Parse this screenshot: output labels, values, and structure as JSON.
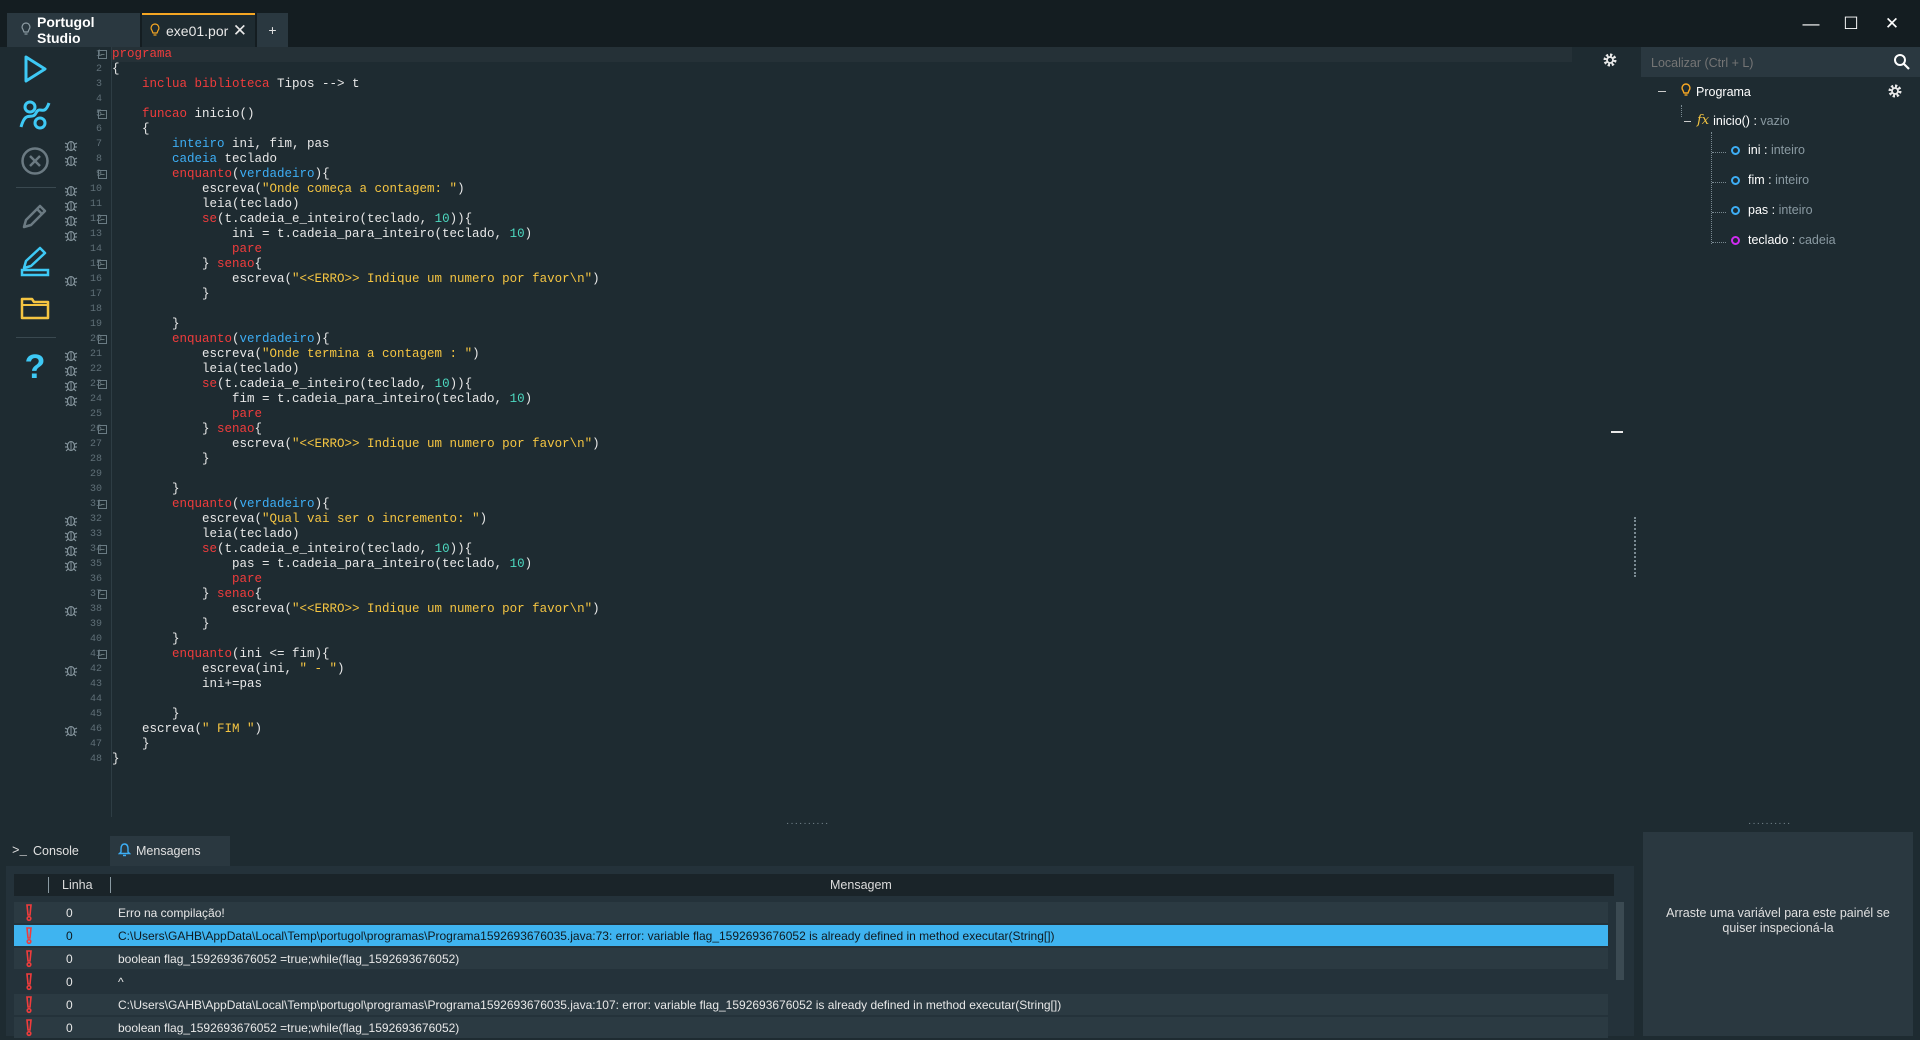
{
  "titlebar": {
    "home_tab": "Portugol Studio",
    "file_tab": "exe01.por",
    "add_tab": "+",
    "close_symbol": "✕",
    "window_minimize": "—",
    "window_maximize": "☐",
    "window_close": "✕"
  },
  "toolbar": {
    "icons": [
      "run-icon",
      "debug-step-icon",
      "stop-icon",
      "edit-icon",
      "edit-save-icon",
      "folder-icon",
      "help-icon"
    ],
    "help_symbol": "?"
  },
  "editor": {
    "line_numbers": [
      "1",
      "2",
      "3",
      "4",
      "5",
      "6",
      "7",
      "8",
      "9",
      "10",
      "11",
      "12",
      "13",
      "14",
      "15",
      "16",
      "17",
      "18",
      "19",
      "20",
      "21",
      "22",
      "23",
      "24",
      "25",
      "26",
      "27",
      "28",
      "29",
      "30",
      "31",
      "32",
      "33",
      "34",
      "35",
      "36",
      "37",
      "38",
      "39",
      "40",
      "41",
      "42",
      "43",
      "44",
      "45",
      "46",
      "47",
      "48"
    ],
    "lines": [
      [
        [
          "kw",
          "programa"
        ]
      ],
      [
        [
          "plain",
          "{"
        ]
      ],
      [
        [
          "plain",
          "    "
        ],
        [
          "kw",
          "inclua biblioteca"
        ],
        [
          "plain",
          " Tipos --> t"
        ]
      ],
      [],
      [
        [
          "plain",
          "    "
        ],
        [
          "kw",
          "funcao"
        ],
        [
          "plain",
          " inicio()"
        ]
      ],
      [
        [
          "plain",
          "    {"
        ]
      ],
      [
        [
          "plain",
          "        "
        ],
        [
          "type",
          "inteiro"
        ],
        [
          "plain",
          " ini, fim, pas"
        ]
      ],
      [
        [
          "plain",
          "        "
        ],
        [
          "type",
          "cadeia"
        ],
        [
          "plain",
          " teclado"
        ]
      ],
      [
        [
          "plain",
          "        "
        ],
        [
          "kw",
          "enquanto"
        ],
        [
          "plain",
          "("
        ],
        [
          "bool",
          "verdadeiro"
        ],
        [
          "plain",
          "){"
        ]
      ],
      [
        [
          "plain",
          "            escreva("
        ],
        [
          "str",
          "\"Onde começa a contagem: \""
        ],
        [
          "plain",
          ")"
        ]
      ],
      [
        [
          "plain",
          "            leia(teclado)"
        ]
      ],
      [
        [
          "plain",
          "            "
        ],
        [
          "kw",
          "se"
        ],
        [
          "plain",
          "(t.cadeia_e_inteiro(teclado, "
        ],
        [
          "num",
          "10"
        ],
        [
          "plain",
          ")){"
        ]
      ],
      [
        [
          "plain",
          "                ini = t.cadeia_para_inteiro(teclado, "
        ],
        [
          "num",
          "10"
        ],
        [
          "plain",
          ")"
        ]
      ],
      [
        [
          "plain",
          "                "
        ],
        [
          "kw",
          "pare"
        ]
      ],
      [
        [
          "plain",
          "            } "
        ],
        [
          "kw",
          "senao"
        ],
        [
          "plain",
          "{"
        ]
      ],
      [
        [
          "plain",
          "                escreva("
        ],
        [
          "str",
          "\"<<ERRO>> Indique um numero por favor\\n\""
        ],
        [
          "plain",
          ")"
        ]
      ],
      [
        [
          "plain",
          "            }"
        ]
      ],
      [],
      [
        [
          "plain",
          "        }"
        ]
      ],
      [
        [
          "plain",
          "        "
        ],
        [
          "kw",
          "enquanto"
        ],
        [
          "plain",
          "("
        ],
        [
          "bool",
          "verdadeiro"
        ],
        [
          "plain",
          "){"
        ]
      ],
      [
        [
          "plain",
          "            escreva("
        ],
        [
          "str",
          "\"Onde termina a contagem : \""
        ],
        [
          "plain",
          ")"
        ]
      ],
      [
        [
          "plain",
          "            leia(teclado)"
        ]
      ],
      [
        [
          "plain",
          "            "
        ],
        [
          "kw",
          "se"
        ],
        [
          "plain",
          "(t.cadeia_e_inteiro(teclado, "
        ],
        [
          "num",
          "10"
        ],
        [
          "plain",
          ")){"
        ]
      ],
      [
        [
          "plain",
          "                fim = t.cadeia_para_inteiro(teclado, "
        ],
        [
          "num",
          "10"
        ],
        [
          "plain",
          ")"
        ]
      ],
      [
        [
          "plain",
          "                "
        ],
        [
          "kw",
          "pare"
        ]
      ],
      [
        [
          "plain",
          "            } "
        ],
        [
          "kw",
          "senao"
        ],
        [
          "plain",
          "{"
        ]
      ],
      [
        [
          "plain",
          "                escreva("
        ],
        [
          "str",
          "\"<<ERRO>> Indique um numero por favor\\n\""
        ],
        [
          "plain",
          ")"
        ]
      ],
      [
        [
          "plain",
          "            }"
        ]
      ],
      [],
      [
        [
          "plain",
          "        }"
        ]
      ],
      [
        [
          "plain",
          "        "
        ],
        [
          "kw",
          "enquanto"
        ],
        [
          "plain",
          "("
        ],
        [
          "bool",
          "verdadeiro"
        ],
        [
          "plain",
          "){"
        ]
      ],
      [
        [
          "plain",
          "            escreva("
        ],
        [
          "str",
          "\"Qual vai ser o incremento: \""
        ],
        [
          "plain",
          ")"
        ]
      ],
      [
        [
          "plain",
          "            leia(teclado)"
        ]
      ],
      [
        [
          "plain",
          "            "
        ],
        [
          "kw",
          "se"
        ],
        [
          "plain",
          "(t.cadeia_e_inteiro(teclado, "
        ],
        [
          "num",
          "10"
        ],
        [
          "plain",
          ")){"
        ]
      ],
      [
        [
          "plain",
          "                pas = t.cadeia_para_inteiro(teclado, "
        ],
        [
          "num",
          "10"
        ],
        [
          "plain",
          ")"
        ]
      ],
      [
        [
          "plain",
          "                "
        ],
        [
          "kw",
          "pare"
        ]
      ],
      [
        [
          "plain",
          "            } "
        ],
        [
          "kw",
          "senao"
        ],
        [
          "plain",
          "{"
        ]
      ],
      [
        [
          "plain",
          "                escreva("
        ],
        [
          "str",
          "\"<<ERRO>> Indique um numero por favor\\n\""
        ],
        [
          "plain",
          ")"
        ]
      ],
      [
        [
          "plain",
          "            }"
        ]
      ],
      [
        [
          "plain",
          "        }"
        ]
      ],
      [
        [
          "plain",
          "        "
        ],
        [
          "kw",
          "enquanto"
        ],
        [
          "plain",
          "(ini <= fim){"
        ]
      ],
      [
        [
          "plain",
          "            escreva(ini, "
        ],
        [
          "str",
          "\" - \""
        ],
        [
          "plain",
          ")"
        ]
      ],
      [
        [
          "plain",
          "            ini+=pas"
        ]
      ],
      [],
      [
        [
          "plain",
          "        }"
        ]
      ],
      [
        [
          "plain",
          "    escreva("
        ],
        [
          "str",
          "\" FIM \""
        ],
        [
          "plain",
          ")"
        ]
      ],
      [
        [
          "plain",
          "    }"
        ]
      ],
      [
        [
          "plain",
          "}"
        ]
      ]
    ],
    "fold_lines": [
      1,
      5,
      9,
      12,
      15,
      20,
      23,
      26,
      31,
      34,
      37,
      41
    ],
    "bug_lines": [
      7,
      8,
      10,
      11,
      12,
      13,
      16,
      21,
      22,
      23,
      24,
      27,
      32,
      33,
      34,
      35,
      38,
      42,
      46
    ]
  },
  "outline": {
    "search_placeholder": "Localizar (Ctrl + L)",
    "program": "Programa",
    "function_icon": "fx",
    "function_name": "inicio()",
    "function_sep": " : ",
    "function_type": "vazio",
    "variables": [
      {
        "name": "ini",
        "type": "inteiro",
        "color": "#3daef5"
      },
      {
        "name": "fim",
        "type": "inteiro",
        "color": "#3daef5"
      },
      {
        "name": "pas",
        "type": "inteiro",
        "color": "#3daef5"
      },
      {
        "name": "teclado",
        "type": "cadeia",
        "color": "#d02bf0"
      }
    ]
  },
  "bottom": {
    "console_prompt": ">_",
    "console_tab": "Console",
    "messages_tab": "Mensagens",
    "col_line": "Linha",
    "col_message": "Mensagem",
    "rows": [
      {
        "line": "0",
        "text": "Erro na compilação!",
        "state": "alt"
      },
      {
        "line": "0",
        "text": "C:\\Users\\GAHB\\AppData\\Local\\Temp\\portugol\\programas\\Programa1592693676035.java:73: error: variable flag_1592693676052 is already defined in method executar(String[])",
        "state": "sel"
      },
      {
        "line": "0",
        "text": "boolean flag_1592693676052 =true;while(flag_1592693676052)",
        "state": "alt"
      },
      {
        "line": "0",
        "text": "^",
        "state": ""
      },
      {
        "line": "0",
        "text": "C:\\Users\\GAHB\\AppData\\Local\\Temp\\portugol\\programas\\Programa1592693676035.java:107: error: variable flag_1592693676052 is already defined in method executar(String[])",
        "state": "alt"
      },
      {
        "line": "0",
        "text": "boolean flag_1592693676052 =true;while(flag_1592693676052)",
        "state": "alt"
      }
    ]
  },
  "inspector": {
    "hint": "Arraste uma variável para este painél se quiser inspecioná-la"
  },
  "colors": {
    "accent": "#3fb4f0",
    "keyword": "#f03c3c",
    "type": "#3daef5",
    "string": "#f5c542",
    "number": "#4dd9c0",
    "background": "#1e2b31"
  }
}
